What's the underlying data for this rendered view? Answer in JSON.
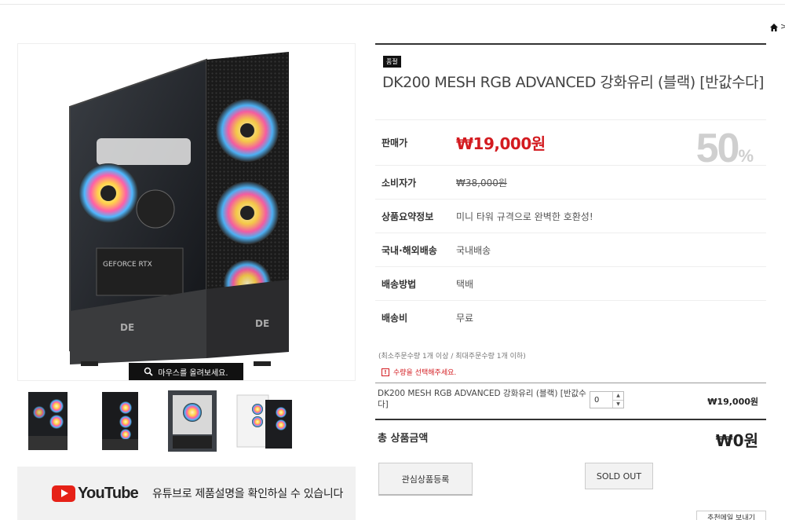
{
  "breadcrumb": {
    "home_icon": "home-icon",
    "tail": ">"
  },
  "gallery": {
    "zoom_hint": "마우스를 올려보세요.",
    "thumbnails": [
      {
        "alt": "black-case-front"
      },
      {
        "alt": "black-case-angle"
      },
      {
        "alt": "black-case-glass"
      },
      {
        "alt": "white-and-black-cases"
      }
    ]
  },
  "youtube": {
    "logo_word": "YouTube",
    "text": "유튜브로 제품설명을 확인하실 수 있습니다"
  },
  "product": {
    "badge": "품절",
    "title": "DK200 MESH RGB ADVANCED 강화유리 (블랙) [반값수다]",
    "rows": [
      {
        "label": "판매가",
        "value": "₩19,000원"
      },
      {
        "label": "소비자가",
        "value": "₩38,000원"
      },
      {
        "label": "상품요약정보",
        "value": "미니 타워 규격으로 완벽한 호환성!"
      },
      {
        "label": "국내·해외배송",
        "value": "국내배송"
      },
      {
        "label": "배송방법",
        "value": "택배"
      },
      {
        "label": "배송비",
        "value": "무료"
      }
    ],
    "discount_num": "50",
    "discount_sym": "%",
    "limits": "(최소주문수량 1개 이상 / 최대주문수량 1개 이하)",
    "warning_icon": "!",
    "warning": "수량을 선택해주세요.",
    "option": {
      "name": "DK200 MESH RGB ADVANCED 강화유리 (블랙) [반값수다]",
      "qty": "0",
      "price": "₩19,000원"
    },
    "total_label": "총 상품금액",
    "total_value": "₩0원",
    "buttons": {
      "wishlist": "관심상품등록",
      "sold_out": "SOLD OUT",
      "recommend": "추천메일 보내기"
    }
  },
  "colors": {
    "accent_red": "#d31b20",
    "discount_gray": "#cfcfcf",
    "badge_black": "#111111"
  }
}
